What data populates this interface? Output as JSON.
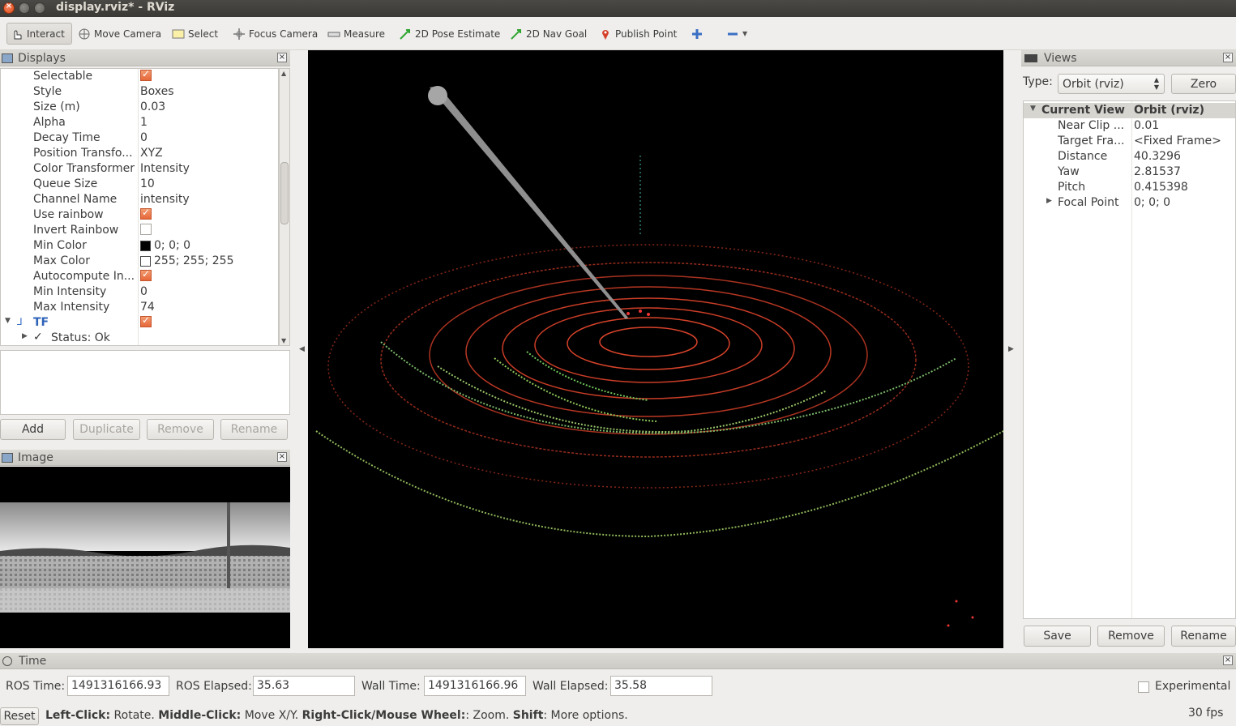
{
  "window": {
    "title": "display.rviz* - RViz"
  },
  "toolbar": {
    "interact": "Interact",
    "move_camera": "Move Camera",
    "select": "Select",
    "focus_camera": "Focus Camera",
    "measure": "Measure",
    "pose_estimate": "2D Pose Estimate",
    "nav_goal": "2D Nav Goal",
    "publish_point": "Publish Point"
  },
  "displays": {
    "title": "Displays",
    "rows": [
      {
        "key": "Selectable",
        "value": "",
        "type": "checkbox",
        "checked": true
      },
      {
        "key": "Style",
        "value": "Boxes"
      },
      {
        "key": "Size (m)",
        "value": "0.03"
      },
      {
        "key": "Alpha",
        "value": "1"
      },
      {
        "key": "Decay Time",
        "value": "0"
      },
      {
        "key": "Position Transfo...",
        "value": "XYZ"
      },
      {
        "key": "Color Transformer",
        "value": "Intensity"
      },
      {
        "key": "Queue Size",
        "value": "10"
      },
      {
        "key": "Channel Name",
        "value": "intensity"
      },
      {
        "key": "Use rainbow",
        "value": "",
        "type": "checkbox",
        "checked": true
      },
      {
        "key": "Invert Rainbow",
        "value": "",
        "type": "checkbox",
        "checked": false
      },
      {
        "key": "Min Color",
        "value": "0; 0; 0",
        "type": "color",
        "color": "#000000"
      },
      {
        "key": "Max Color",
        "value": "255; 255; 255",
        "type": "color",
        "color": "#ffffff"
      },
      {
        "key": "Autocompute In...",
        "value": "",
        "type": "checkbox",
        "checked": true
      },
      {
        "key": "Min Intensity",
        "value": "0"
      },
      {
        "key": "Max Intensity",
        "value": "74"
      }
    ],
    "tf_label": "TF",
    "status_label": "Status: Ok",
    "buttons": {
      "add": "Add",
      "duplicate": "Duplicate",
      "remove": "Remove",
      "rename": "Rename"
    }
  },
  "image_panel": {
    "title": "Image"
  },
  "views": {
    "title": "Views",
    "type_label": "Type:",
    "type_value": "Orbit (rviz)",
    "zero": "Zero",
    "header_key": "Current View",
    "header_value": "Orbit (rviz)",
    "rows": [
      {
        "key": "Near Clip ...",
        "value": "0.01"
      },
      {
        "key": "Target Fra...",
        "value": "<Fixed Frame>"
      },
      {
        "key": "Distance",
        "value": "40.3296"
      },
      {
        "key": "Yaw",
        "value": "2.81537"
      },
      {
        "key": "Pitch",
        "value": "0.415398"
      },
      {
        "key": "Focal Point",
        "value": "0; 0; 0"
      }
    ],
    "buttons": {
      "save": "Save",
      "remove": "Remove",
      "rename": "Rename"
    }
  },
  "time": {
    "title": "Time",
    "ros_time_label": "ROS Time:",
    "ros_time": "1491316166.93",
    "ros_elapsed_label": "ROS Elapsed:",
    "ros_elapsed": "35.63",
    "wall_time_label": "Wall Time:",
    "wall_time": "1491316166.96",
    "wall_elapsed_label": "Wall Elapsed:",
    "wall_elapsed": "35.58",
    "experimental": "Experimental"
  },
  "status": {
    "reset": "Reset",
    "left_click": "Left-Click:",
    "left_click_desc": " Rotate. ",
    "middle_click": "Middle-Click:",
    "middle_click_desc": " Move X/Y. ",
    "right_click": "Right-Click/Mouse Wheel:",
    "right_click_desc": ": Zoom. ",
    "shift": "Shift",
    "shift_desc": ": More options.",
    "fps": "30 fps"
  }
}
